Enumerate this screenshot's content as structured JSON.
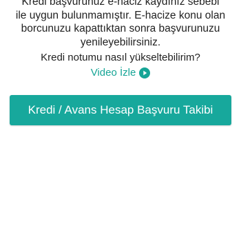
{
  "message": {
    "text": "Kredi başvurunuz e-haciz kaydınız sebebi\nile uygun bulunmamıştır. E-hacize konu olan\nborcunuzu kapattıktan sonra başvurunuzu\nyenileyebilirsiniz."
  },
  "help": {
    "question": "Kredi notumu nasıl yükseltebilirim?",
    "video_label": "Video İzle",
    "video_icon": "play-circle-icon"
  },
  "actions": {
    "primary_label": "Kredi / Avans Hesap Başvuru Takibi"
  },
  "colors": {
    "accent": "#17a89c",
    "link": "#16a596",
    "text": "#212121",
    "background": "#ffffff"
  }
}
